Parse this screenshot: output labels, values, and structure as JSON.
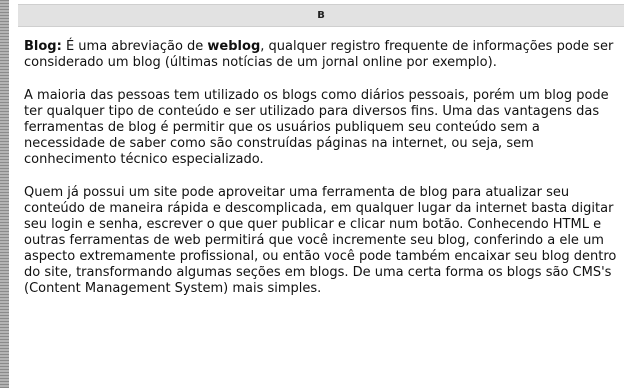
{
  "header": {
    "letter": "B"
  },
  "entry": {
    "term": "Blog:",
    "p1_before": " É uma abreviação de ",
    "p1_bold": "weblog",
    "p1_after": ", qualquer registro frequente de informações pode ser considerado um blog (últimas notícias de um jornal online por exemplo).",
    "p2": "A maioria das pessoas tem utilizado os blogs como diários pessoais, porém um blog pode ter qualquer tipo de conteúdo e ser utilizado para diversos fins. Uma das vantagens das ferramentas de blog é permitir que os usuários publiquem seu conteúdo sem a necessidade de saber como são construídas páginas na internet, ou seja, sem conhecimento técnico especializado.",
    "p3": "Quem já possui um site pode aproveitar uma ferramenta de blog para atualizar seu conteúdo de maneira rápida e descomplicada, em qualquer lugar da internet basta digitar seu login e senha, escrever o que quer publicar e clicar num botão. Conhecendo HTML e outras ferramentas de web permitirá que você incremente seu blog, conferindo a ele um aspecto extremamente profissional, ou então você pode também encaixar seu blog dentro do site, transformando algumas seções em blogs. De uma certa forma os blogs são CMS's (Content Management System) mais simples."
  }
}
